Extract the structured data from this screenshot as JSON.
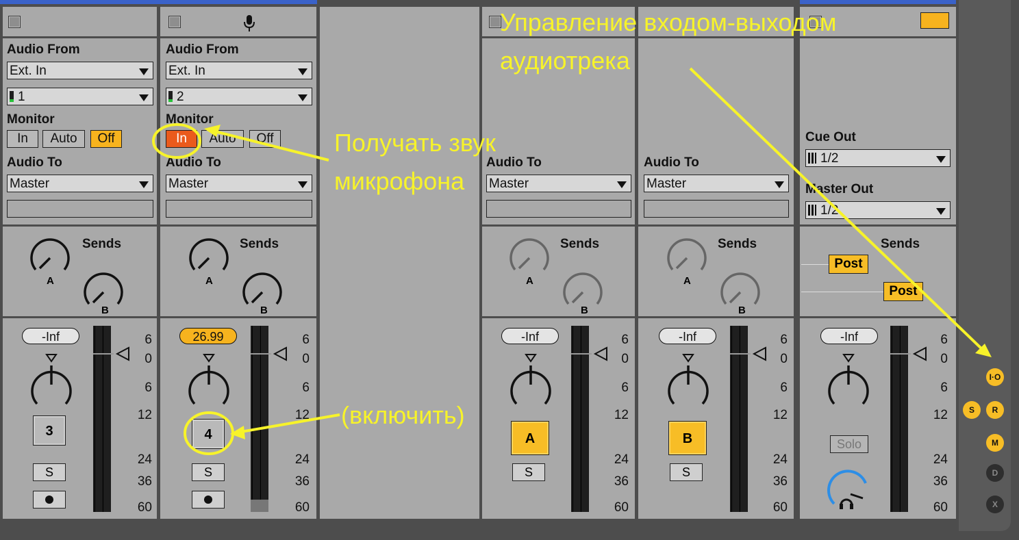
{
  "tracks": [
    {
      "header_button": "",
      "audio_from_label": "Audio From",
      "audio_from_value": "Ext. In",
      "channel_value": "1",
      "monitor_label": "Monitor",
      "monitor_in": "In",
      "monitor_auto": "Auto",
      "monitor_off": "Off",
      "audio_to_label": "Audio To",
      "audio_to_value": "Master",
      "sends_label": "Sends",
      "send_a": "A",
      "send_b": "B",
      "volume": "-Inf",
      "track_number": "3",
      "solo": "S",
      "meter_scale": [
        "6",
        "0",
        "6",
        "12",
        "24",
        "36",
        "60"
      ]
    },
    {
      "audio_from_label": "Audio From",
      "audio_from_value": "Ext. In",
      "channel_value": "2",
      "monitor_label": "Monitor",
      "monitor_in": "In",
      "monitor_auto": "Auto",
      "monitor_off": "Off",
      "audio_to_label": "Audio To",
      "audio_to_value": "Master",
      "sends_label": "Sends",
      "send_a": "A",
      "send_b": "B",
      "volume": "26.99",
      "track_number": "4",
      "solo": "S",
      "meter_scale": [
        "6",
        "0",
        "6",
        "12",
        "24",
        "36",
        "60"
      ]
    },
    {
      "audio_to_label": "Audio To",
      "audio_to_value": "Master",
      "sends_label": "Sends",
      "send_a": "A",
      "send_b": "B",
      "volume": "-Inf",
      "track_number": "A",
      "solo": "S",
      "meter_scale": [
        "6",
        "0",
        "6",
        "12",
        "24",
        "36",
        "60"
      ]
    },
    {
      "audio_to_label": "Audio To",
      "audio_to_value": "Master",
      "sends_label": "Sends",
      "send_a": "A",
      "send_b": "B",
      "volume": "-Inf",
      "track_number": "B",
      "solo": "S",
      "meter_scale": [
        "6",
        "0",
        "6",
        "12",
        "24",
        "36",
        "60"
      ]
    },
    {
      "cue_out_label": "Cue Out",
      "cue_out_value": "1/2",
      "master_out_label": "Master Out",
      "master_out_value": "1/2",
      "sends_label": "Sends",
      "post_a": "Post",
      "post_b": "Post",
      "volume": "-Inf",
      "solo": "Solo",
      "meter_scale": [
        "6",
        "0",
        "6",
        "12",
        "24",
        "36",
        "60"
      ]
    }
  ],
  "side_buttons": {
    "io": "I·O",
    "s": "S",
    "r": "R",
    "m": "M",
    "d": "D",
    "x": "X"
  },
  "annotations": {
    "io_title_line1": "Управление входом-выходом",
    "io_title_line2": "аудиотрека",
    "mic_line1": "Получать звук",
    "mic_line2": "микрофона",
    "enable": "(включить)"
  },
  "colors": {
    "annotation": "#f7f32a",
    "active_orange": "#f7b31e",
    "monitor_in_red": "#ea5a1c",
    "panel": "#a9a9a9",
    "background": "#4d4d4d"
  }
}
